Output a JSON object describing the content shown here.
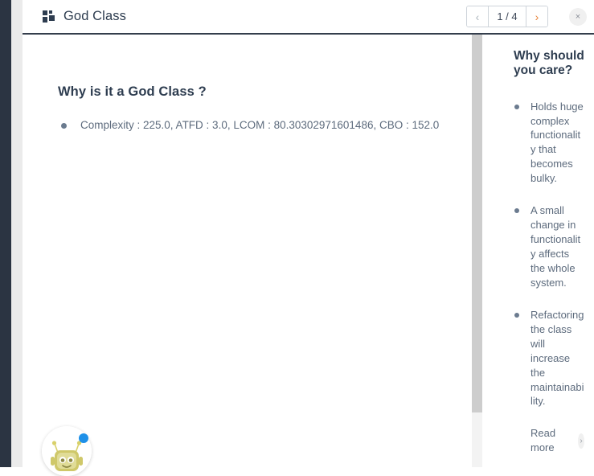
{
  "header": {
    "icon": "grid-icon",
    "title": "God Class",
    "pagination": {
      "prev_icon": "chevron-left-icon",
      "next_icon": "chevron-right-icon",
      "label": "1 / 4",
      "current_page": 1,
      "total_pages": 4
    },
    "close_icon": "close-icon",
    "close_label": "×"
  },
  "main": {
    "heading": "Why is it a God Class ?",
    "bullets": [
      "Complexity : 225.0, ATFD : 3.0, LCOM : 80.30302971601486, CBO : 152.0"
    ]
  },
  "sidebar": {
    "heading": "Why should you care?",
    "bullets": [
      "Holds huge complex functionality that becomes bulky.",
      "A small change in functionality affects the whole system.",
      "Refactoring the class will increase the maintainability."
    ],
    "read_more_label": "Read more",
    "read_more_icon": "chevron-right-circle-icon"
  },
  "chatbot": {
    "avatar_icon": "robot-avatar-icon",
    "badge_icon": "notification-dot-icon"
  },
  "colors": {
    "rail": "#2b3442",
    "title": "#2e3d50",
    "body_text": "#5d6b7d",
    "next_arrow": "#e8833a",
    "prev_arrow": "#adb5bd",
    "badge": "#1e90e8",
    "scrollbar": "#cdcdcd"
  }
}
